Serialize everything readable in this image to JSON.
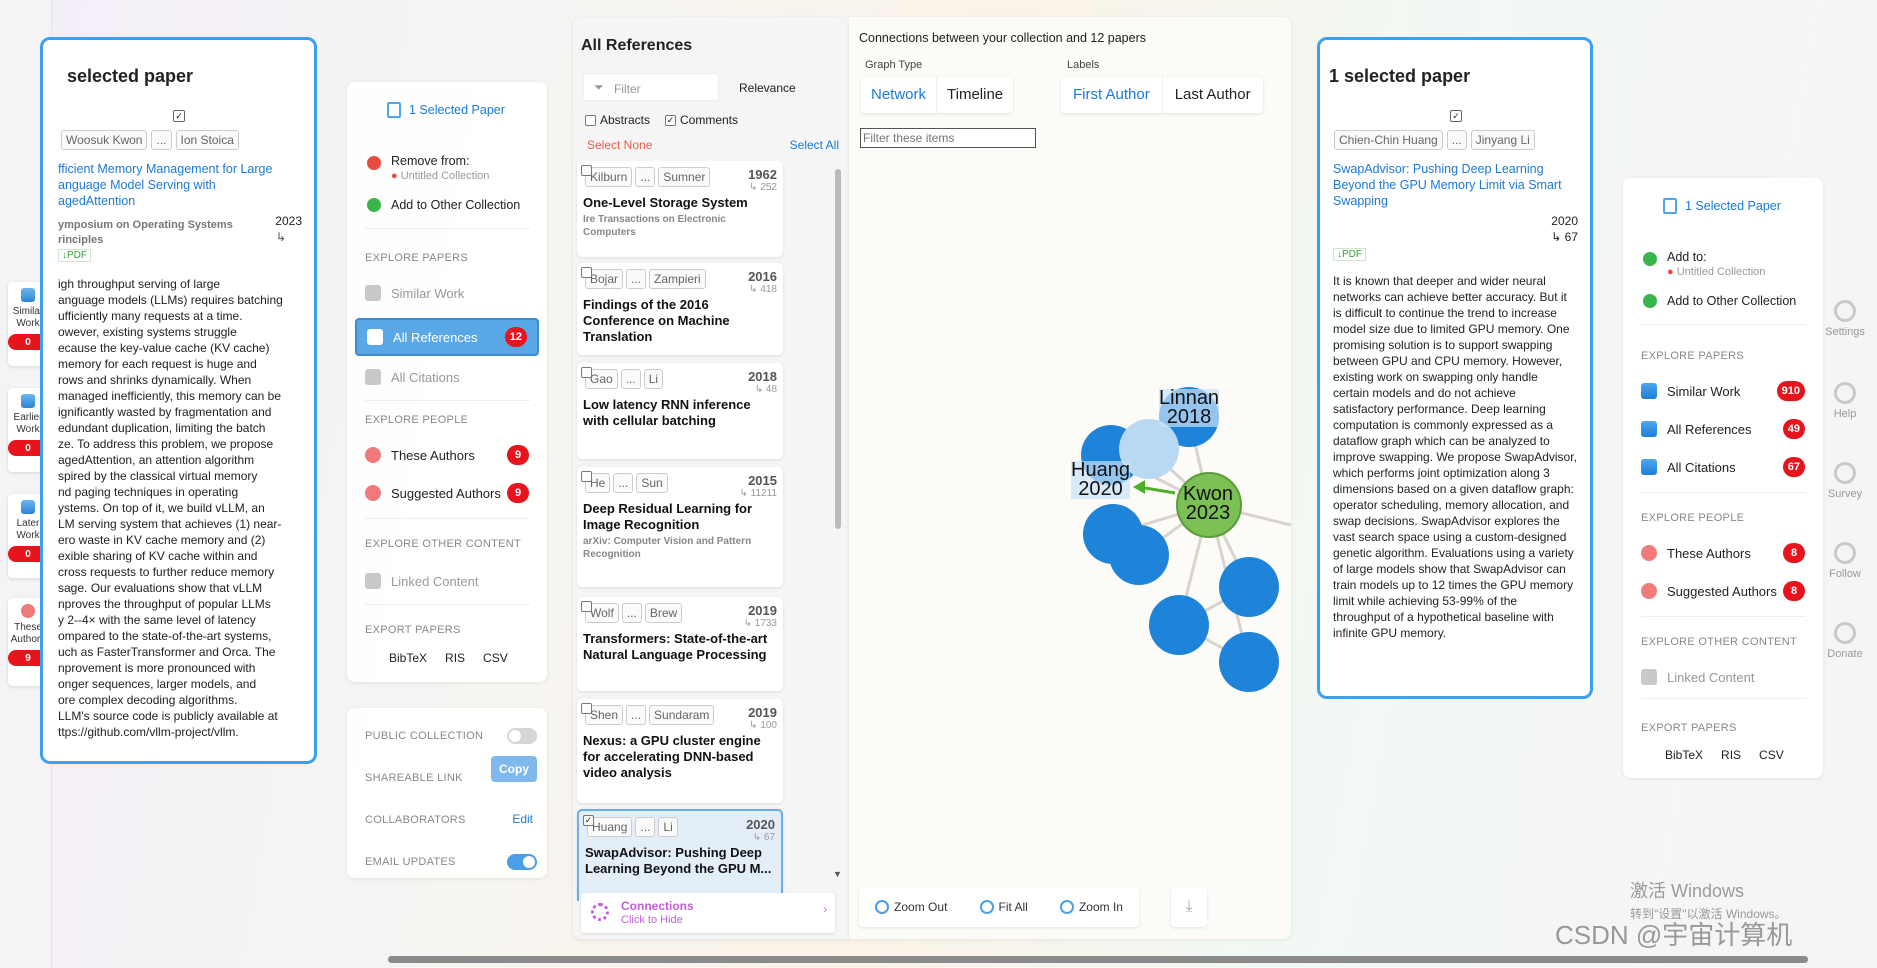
{
  "left_sidenav": [
    {
      "label": "Similar\nWork",
      "count": "0"
    },
    {
      "label": "Earlier\nWork",
      "count": "0"
    },
    {
      "label": "Later\nWork",
      "count": "0"
    },
    {
      "label": "These\nAuthors",
      "count": "9"
    }
  ],
  "left_paper": {
    "header": "selected paper",
    "authors": [
      "Woosuk Kwon",
      "...",
      "Ion Stoica"
    ],
    "title": "fficient Memory Management for Large\nanguage Model Serving with\nagedAttention",
    "venue": "ymposium on Operating Systems\nrinciples",
    "year": "2023",
    "cite_arrow": "↳",
    "pdf": "↓PDF",
    "abstract": "igh throughput serving of large\nanguage models (LLMs) requires batching\nufficiently many requests at a time.\nowever, existing systems struggle\necause the key-value cache (KV cache)\nmemory for each request is huge and\nrows and shrinks dynamically. When\nmanaged inefficiently, this memory can be\nignificantly wasted by fragmentation and\nedundant duplication, limiting the batch\nze. To address this problem, we propose\nagedAttention, an attention algorithm\nspired by the classical virtual memory\nnd paging techniques in operating\nystems. On top of it, we build vLLM, an\nLM serving system that achieves (1) near-\nero waste in KV cache memory and (2)\nexible sharing of KV cache within and\ncross requests to further reduce memory\nsage. Our evaluations show that vLLM\nnproves the throughput of popular LLMs\ny 2--4× with the same level of latency\nompared to the state-of-the-art systems,\nuch as FasterTransformer and Orca. The\nnprovement is more pronounced with\nonger sequences, larger models, and\nore complex decoding algorithms.\nLLM's source code is publicly available at\nttps://github.com/vllm-project/vllm."
  },
  "left_menu": {
    "selected_label": "1 Selected Paper",
    "remove_from": "Remove from:",
    "untitled": "Untitled Collection",
    "add_other": "Add to Other Collection",
    "explore_papers": "EXPLORE PAPERS",
    "similar_work": "Similar Work",
    "all_references": "All References",
    "all_references_count": "12",
    "all_citations": "All Citations",
    "explore_people": "EXPLORE PEOPLE",
    "these_authors": "These Authors",
    "these_authors_count": "9",
    "suggested_authors": "Suggested Authors",
    "suggested_authors_count": "9",
    "explore_other": "EXPLORE OTHER CONTENT",
    "linked_content": "Linked Content",
    "export_papers": "EXPORT PAPERS",
    "bibtex": "BibTeX",
    "ris": "RIS",
    "csv": "CSV"
  },
  "collection_settings": {
    "public_collection": "PUBLIC COLLECTION",
    "shareable_link": "SHAREABLE LINK",
    "copy": "Copy",
    "collaborators": "COLLABORATORS",
    "edit": "Edit",
    "email_updates": "EMAIL UPDATES"
  },
  "references": {
    "title": "All References",
    "filter_placeholder": "Filter",
    "sort": "Relevance",
    "abstracts": "Abstracts",
    "comments": "Comments",
    "select_none": "Select None",
    "select_all": "Select All",
    "items": [
      {
        "a1": "Kilburn",
        "a2": "Sumner",
        "year": "1962",
        "cites": "↳ 252",
        "title": "One-Level Storage System",
        "venue": "Ire Transactions on Electronic Computers"
      },
      {
        "a1": "Bojar",
        "a2": "Zampieri",
        "year": "2016",
        "cites": "↳ 418",
        "title": "Findings of the 2016 Conference on Machine Translation",
        "venue": ""
      },
      {
        "a1": "Gao",
        "a2": "Li",
        "year": "2018",
        "cites": "↳ 48",
        "title": "Low latency RNN inference with cellular batching",
        "venue": ""
      },
      {
        "a1": "He",
        "a2": "Sun",
        "year": "2015",
        "cites": "↳ 11211",
        "title": "Deep Residual Learning for Image Recognition",
        "venue": "arXiv: Computer Vision and Pattern Recognition"
      },
      {
        "a1": "Wolf",
        "a2": "Brew",
        "year": "2019",
        "cites": "↳ 1733",
        "title": "Transformers: State-of-the-art Natural Language Processing",
        "venue": ""
      },
      {
        "a1": "Shen",
        "a2": "Sundaram",
        "year": "2019",
        "cites": "↳ 100",
        "title": "Nexus: a GPU cluster engine for accelerating DNN-based video analysis",
        "venue": ""
      },
      {
        "a1": "Huang",
        "a2": "Li",
        "year": "2020",
        "cites": "↳ 67",
        "title": "SwapAdvisor: Pushing Deep Learning Beyond the GPU M...",
        "venue": ""
      }
    ],
    "ellipsis": "...",
    "connections": "Connections",
    "click_to_hide": "Click to Hide"
  },
  "graph": {
    "header": "Connections between your collection and 12 papers",
    "graph_type": "Graph Type",
    "network": "Network",
    "timeline": "Timeline",
    "labels": "Labels",
    "first_author": "First Author",
    "last_author": "Last Author",
    "filter_placeholder": "Filter these items",
    "node_labels": [
      "Linnan\n2018",
      "Huang\n2020",
      "Kwon\n2023"
    ],
    "zoom_out": "Zoom Out",
    "fit_all": "Fit All",
    "zoom_in": "Zoom In"
  },
  "right_paper": {
    "header": "1 selected paper",
    "authors": [
      "Chien-Chin Huang",
      "...",
      "Jinyang Li"
    ],
    "title": "SwapAdvisor: Pushing Deep Learning\nBeyond the GPU Memory Limit via Smart\nSwapping",
    "year": "2020",
    "cites": "↳ 67",
    "pdf": "↓PDF",
    "abstract": "It is known that deeper and wider neural networks can achieve better accuracy. But it is difficult to continue the trend to increase model size due to limited GPU memory. One promising solution is to support swapping between GPU and CPU memory. However, existing work on swapping only handle certain models and do not achieve satisfactory performance. Deep learning computation is commonly expressed as a dataflow graph which can be analyzed to improve swapping. We propose SwapAdvisor, which performs joint optimization along 3 dimensions based on a given dataflow graph: operator scheduling, memory allocation, and swap decisions. SwapAdvisor explores the vast search space using a custom-designed genetic algorithm. Evaluations using a variety of large models show that SwapAdvisor can train models up to 12 times the GPU memory limit while achieving 53-99% of the throughput of a hypothetical baseline with infinite GPU memory."
  },
  "right_menu": {
    "selected_label": "1 Selected Paper",
    "add_to": "Add to:",
    "untitled": "Untitled Collection",
    "add_other": "Add to Other Collection",
    "explore_papers": "EXPLORE PAPERS",
    "similar_work": "Similar Work",
    "similar_work_count": "910",
    "all_references": "All References",
    "all_references_count": "49",
    "all_citations": "All Citations",
    "all_citations_count": "67",
    "explore_people": "EXPLORE PEOPLE",
    "these_authors": "These Authors",
    "these_authors_count": "8",
    "suggested_authors": "Suggested Authors",
    "suggested_authors_count": "8",
    "explore_other": "EXPLORE OTHER CONTENT",
    "linked_content": "Linked Content",
    "export_papers": "EXPORT PAPERS",
    "bibtex": "BibTeX",
    "ris": "RIS",
    "csv": "CSV"
  },
  "right_tools": {
    "settings": "Settings",
    "help": "Help",
    "survey": "Survey",
    "follow": "Follow",
    "donate": "Donate"
  },
  "watermark": {
    "activate": "激活 Windows",
    "activate_sub": "转到\"设置\"以激活 Windows。",
    "csdn": "CSDN @宇宙计算机"
  }
}
